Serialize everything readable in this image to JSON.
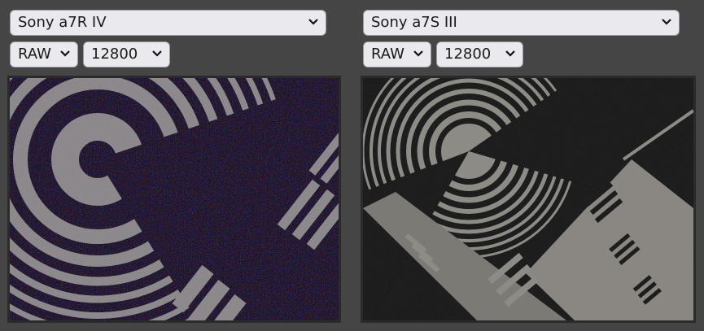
{
  "left_panel": {
    "camera": "Sony a7R IV",
    "format": "RAW",
    "iso": "12800"
  },
  "right_panel": {
    "camera": "Sony a7S III",
    "format": "RAW",
    "iso": "12800"
  },
  "icons": {
    "dropdown": "chevron-down-icon"
  },
  "colors": {
    "background": "#454545",
    "select_bg": "#e9e9ee",
    "chart_light": "#8c8a84",
    "chart_dark": "#141414"
  }
}
